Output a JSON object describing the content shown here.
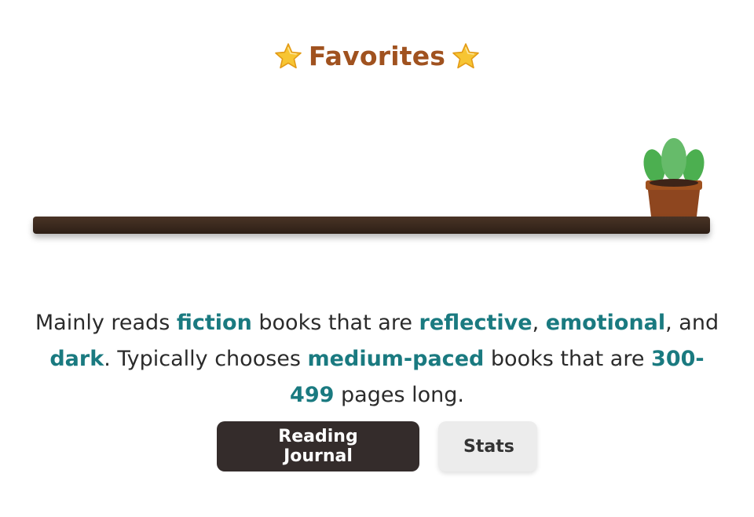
{
  "header": {
    "title": "Favorites",
    "left_icon": "star-icon",
    "right_icon": "star-icon",
    "title_color": "#a0521f"
  },
  "shelf": {
    "decoration_icon": "potted-plant-icon"
  },
  "summary": {
    "p1": "Mainly reads ",
    "genre": "fiction",
    "p2": " books that are ",
    "mood1": "reflective",
    "sep1": ", ",
    "mood2": "emotional",
    "sep2": ", and ",
    "mood3": "dark",
    "p3": ". Typically chooses ",
    "pace": "medium-paced",
    "p4": " books that are ",
    "pages": "300-499",
    "p5": " pages long.",
    "highlight_color": "#1a7a80"
  },
  "actions": {
    "journal_label": "Reading Journal",
    "stats_label": "Stats"
  }
}
